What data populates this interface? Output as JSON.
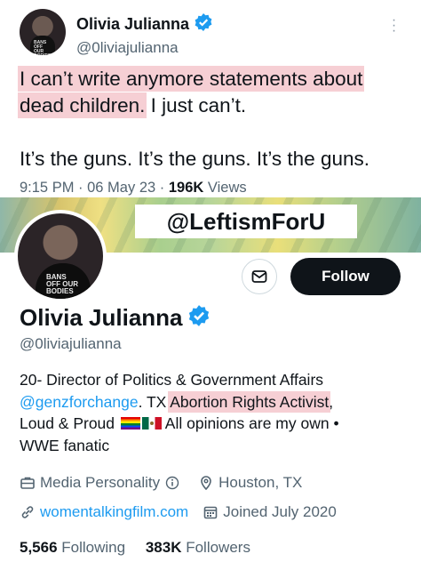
{
  "tweet": {
    "display_name": "Olivia Julianna",
    "handle": "@0liviajulianna",
    "text_highlight_1": "I can’t write anymore statements about",
    "text_highlight_2": "dead children.",
    "text_plain_2": " I just can’t.",
    "text_line3": "It’s the guns. It’s the guns. It’s the guns.",
    "time": "9:15 PM",
    "date": "06 May 23",
    "views_count": "196K",
    "views_label": "Views",
    "avatar_shirt_text": "BANS OFF OUR BODIES"
  },
  "watermark": "@LeftismForU",
  "profile": {
    "display_name": "Olivia Julianna",
    "handle": "@0liviajulianna",
    "follow_label": "Follow",
    "avatar_shirt_text": "BANS OFF OUR BODIES",
    "bio": {
      "line1": "20- Director of Politics & Government Affairs",
      "mention": "@genzforchange",
      "after_mention": ". TX ",
      "highlight": "Abortion Rights Activist",
      "after_highlight": ",",
      "line3_start": "Loud & Proud ",
      "line3_end": " All opinions are my own •",
      "line4": "WWE fanatic"
    },
    "category": "Media Personality",
    "location": "Houston, TX",
    "website": "womentalkingfilm.com",
    "joined": "Joined July 2020",
    "following_count": "5,566",
    "following_label": "Following",
    "followers_count": "383K",
    "followers_label": "Followers"
  },
  "colors": {
    "verified_badge": "#1d9bf0",
    "link": "#1d9bf0",
    "highlight": "#f6cfd4",
    "follow_button": "#0f1419"
  },
  "icons": [
    "verified-badge-icon",
    "more-options-icon",
    "mail-icon",
    "briefcase-icon",
    "info-icon",
    "location-pin-icon",
    "link-icon",
    "calendar-icon"
  ]
}
